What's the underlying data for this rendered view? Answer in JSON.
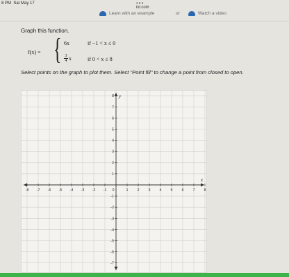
{
  "status": {
    "time": "8 PM",
    "date": "Sat May 17",
    "dots": "•••",
    "url": "ixl.com"
  },
  "help": {
    "learn_label": "Learn with an example",
    "or_label": "or",
    "video_label": "Watch a video"
  },
  "question": "Graph this function.",
  "function": {
    "lhs": "f(x) =",
    "case1_expr": "6x",
    "case1_cond": "if −1 < x ≤ 0",
    "case2_num": "3",
    "case2_den": "4",
    "case2_var": "x",
    "case2_cond": "if 0 < x ≤ 8"
  },
  "instructions": "Select points on the graph to plot them. Select \"Point fill\" to change a point from closed to open.",
  "graph": {
    "x_label": "x",
    "y_label": "y",
    "x_min": -8,
    "x_max": 8,
    "y_min": -7,
    "y_max": 8,
    "x_ticks": [
      "-8",
      "-7",
      "-6",
      "-5",
      "-4",
      "-3",
      "-2",
      "-1",
      "0",
      "1",
      "2",
      "3",
      "4",
      "5",
      "6",
      "7",
      "8"
    ],
    "y_ticks": [
      "8",
      "7",
      "6",
      "5",
      "4",
      "3",
      "2",
      "1",
      "-1",
      "-2",
      "-3",
      "-4",
      "-5",
      "-6",
      "-7"
    ]
  },
  "colors": {
    "accent": "#3bb54a",
    "icon_blue": "#2c68b0"
  }
}
